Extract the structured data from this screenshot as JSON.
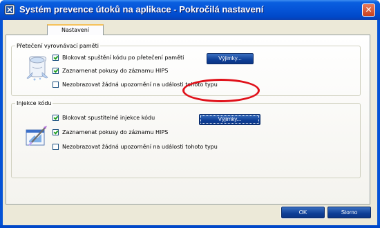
{
  "window": {
    "title": "Systém prevence útoků na aplikace - Pokročilá nastavení",
    "close_symbol": "✕"
  },
  "tabs": [
    {
      "label": "Nastavení",
      "active": true
    }
  ],
  "group_buffer": {
    "title": "Přetečení vyrovnávací paměti",
    "icon": "buffer-overflow-icon",
    "options": [
      {
        "label": "Blokovat spuštění kódu po přetečení paměti",
        "checked": true
      },
      {
        "label": "Zaznamenat pokusy do záznamu HIPS",
        "checked": true
      },
      {
        "label": "Nezobrazovat žádná upozornění na události tohoto typu",
        "checked": false
      }
    ],
    "exceptions_button": "Výjimky..."
  },
  "group_injection": {
    "title": "Injekce kódu",
    "icon": "code-injection-icon",
    "options": [
      {
        "label": "Blokovat spustitelné injekce kódu",
        "checked": true
      },
      {
        "label": "Zaznamenat pokusy do záznamu HIPS",
        "checked": true
      },
      {
        "label": "Nezobrazovat žádná upozornění na události tohoto typu",
        "checked": false
      }
    ],
    "exceptions_button": "Výjimky..."
  },
  "footer": {
    "ok_label": "OK",
    "cancel_label": "Storno"
  },
  "colors": {
    "titlebar": "#0553d6",
    "button": "#0f3f96",
    "highlight": "#e0111a"
  }
}
